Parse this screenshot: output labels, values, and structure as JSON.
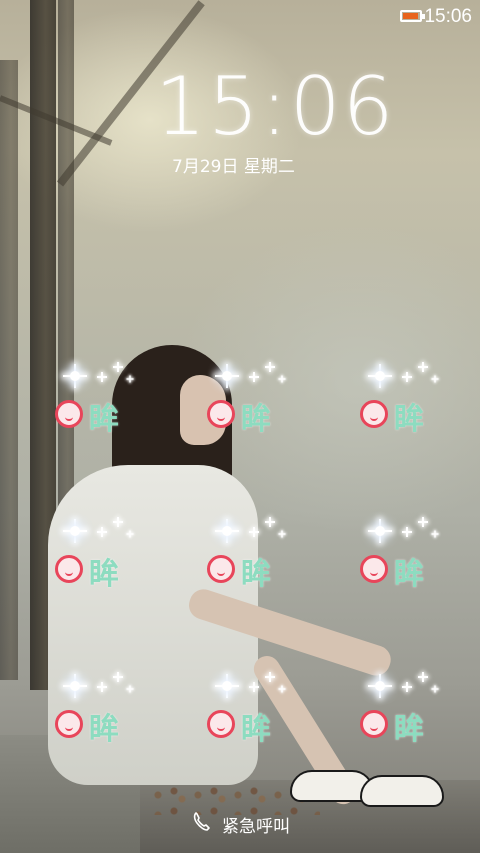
{
  "status_bar": {
    "time": "15:06",
    "battery_level": 0.85,
    "battery_color": "#e8641d"
  },
  "lockscreen": {
    "time": "15:06",
    "date": "7月29日 星期二"
  },
  "grid_nodes": [
    {
      "glyph": "眸",
      "icon": "face-icon"
    },
    {
      "glyph": "眸",
      "icon": "face-icon"
    },
    {
      "glyph": "眸",
      "icon": "face-icon"
    },
    {
      "glyph": "眸",
      "icon": "face-icon"
    },
    {
      "glyph": "眸",
      "icon": "face-icon"
    },
    {
      "glyph": "眸",
      "icon": "face-icon"
    },
    {
      "glyph": "眸",
      "icon": "face-icon"
    },
    {
      "glyph": "眸",
      "icon": "face-icon"
    },
    {
      "glyph": "眸",
      "icon": "face-icon"
    }
  ],
  "emergency": {
    "label": "紧急呼叫",
    "icon": "phone-icon"
  },
  "colors": {
    "node_accent": "#e8455a",
    "glyph": "#8ddcc0"
  }
}
